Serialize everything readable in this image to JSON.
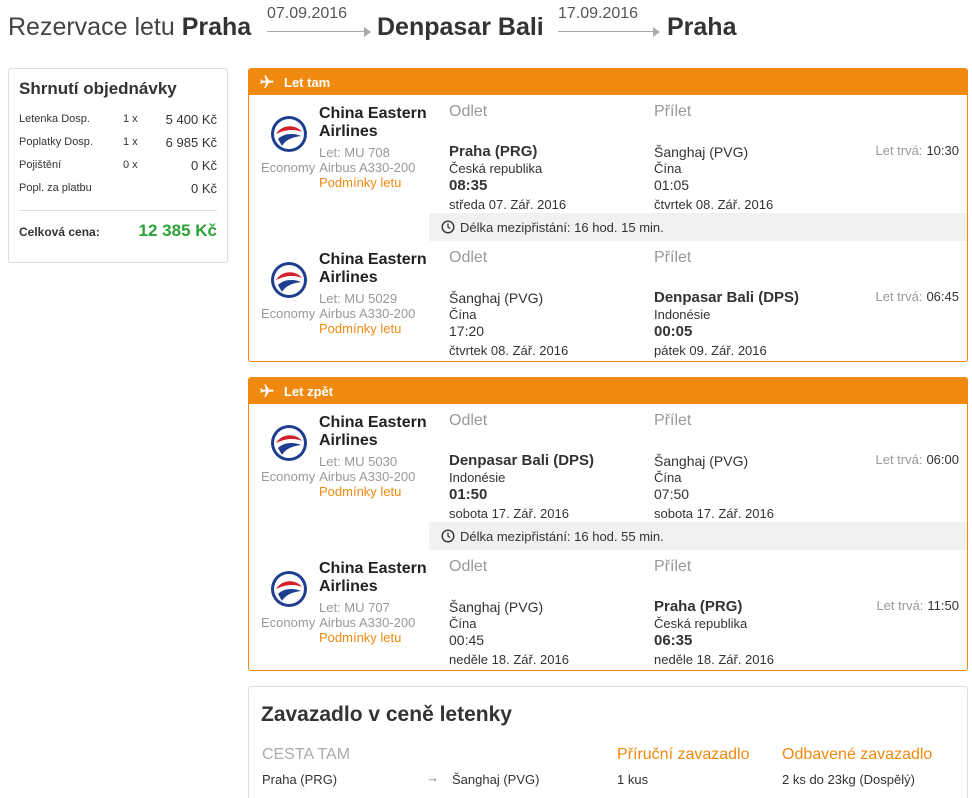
{
  "header": {
    "prefix": "Rezervace letu",
    "origin": "Praha",
    "destination": "Denpasar Bali",
    "return": "Praha",
    "depart_date": "07.09.2016",
    "return_date": "17.09.2016"
  },
  "summary": {
    "title": "Shrnutí objednávky",
    "rows": [
      {
        "label": "Letenka Dosp.",
        "qty": "1 x",
        "price": "5 400 Kč"
      },
      {
        "label": "Poplatky Dosp.",
        "qty": "1 x",
        "price": "6 985 Kč"
      },
      {
        "label": "Pojištění",
        "qty": "0 x",
        "price": "0 Kč"
      },
      {
        "label": "Popl. za platbu",
        "qty": "",
        "price": "0 Kč"
      }
    ],
    "total_label": "Celková cena:",
    "total_price": "12 385 Kč"
  },
  "colors": {
    "accent": "#f0890f",
    "total": "#2aa336"
  },
  "labels": {
    "departure": "Odlet",
    "arrival": "Přílet",
    "duration": "Let trvá:",
    "conditions": "Podmínky letu",
    "cabin": "Economy"
  },
  "outbound": {
    "title": "Let tam",
    "legs": [
      {
        "airline": "China Eastern Airlines",
        "flight": "Let: MU 708",
        "aircraft": "Airbus A330-200",
        "dep": {
          "city": "Praha (PRG)",
          "country": "Česká republika",
          "time": "08:35",
          "date": "středa 07. Zář. 2016"
        },
        "arr": {
          "city": "Šanghaj (PVG)",
          "country": "Čína",
          "time": "01:05",
          "date": "čtvrtek 08. Zář. 2016"
        },
        "duration": "10:30"
      },
      {
        "airline": "China Eastern Airlines",
        "flight": "Let: MU 5029",
        "aircraft": "Airbus A330-200",
        "dep": {
          "city": "Šanghaj (PVG)",
          "country": "Čína",
          "time": "17:20",
          "date": "čtvrtek 08. Zář. 2016"
        },
        "arr": {
          "city": "Denpasar Bali (DPS)",
          "country": "Indonésie",
          "time": "00:05",
          "date": "pátek 09. Zář. 2016"
        },
        "duration": "06:45"
      }
    ],
    "layover": "Délka mezipřistání: 16 hod. 15 min."
  },
  "inbound": {
    "title": "Let zpět",
    "legs": [
      {
        "airline": "China Eastern Airlines",
        "flight": "Let: MU 5030",
        "aircraft": "Airbus A330-200",
        "dep": {
          "city": "Denpasar Bali (DPS)",
          "country": "Indonésie",
          "time": "01:50",
          "date": "sobota 17. Zář. 2016"
        },
        "arr": {
          "city": "Šanghaj (PVG)",
          "country": "Čína",
          "time": "07:50",
          "date": "sobota 17. Zář. 2016"
        },
        "duration": "06:00"
      },
      {
        "airline": "China Eastern Airlines",
        "flight": "Let: MU 707",
        "aircraft": "Airbus A330-200",
        "dep": {
          "city": "Šanghaj (PVG)",
          "country": "Čína",
          "time": "00:45",
          "date": "neděle 18. Zář. 2016"
        },
        "arr": {
          "city": "Praha (PRG)",
          "country": "Česká republika",
          "time": "06:35",
          "date": "neděle 18. Zář. 2016"
        },
        "duration": "11:50"
      }
    ],
    "layover": "Délka mezipřistání: 16 hod. 55 min."
  },
  "baggage": {
    "title": "Zavazadlo v ceně letenky",
    "direction": "CESTA TAM",
    "carry_on_header": "Příruční zavazadlo",
    "checked_header": "Odbavené zavazadlo",
    "row": {
      "from": "Praha (PRG)",
      "to": "Šanghaj (PVG)",
      "carry_on": "1 kus",
      "checked": "2 ks do 23kg (Dospělý)"
    }
  }
}
